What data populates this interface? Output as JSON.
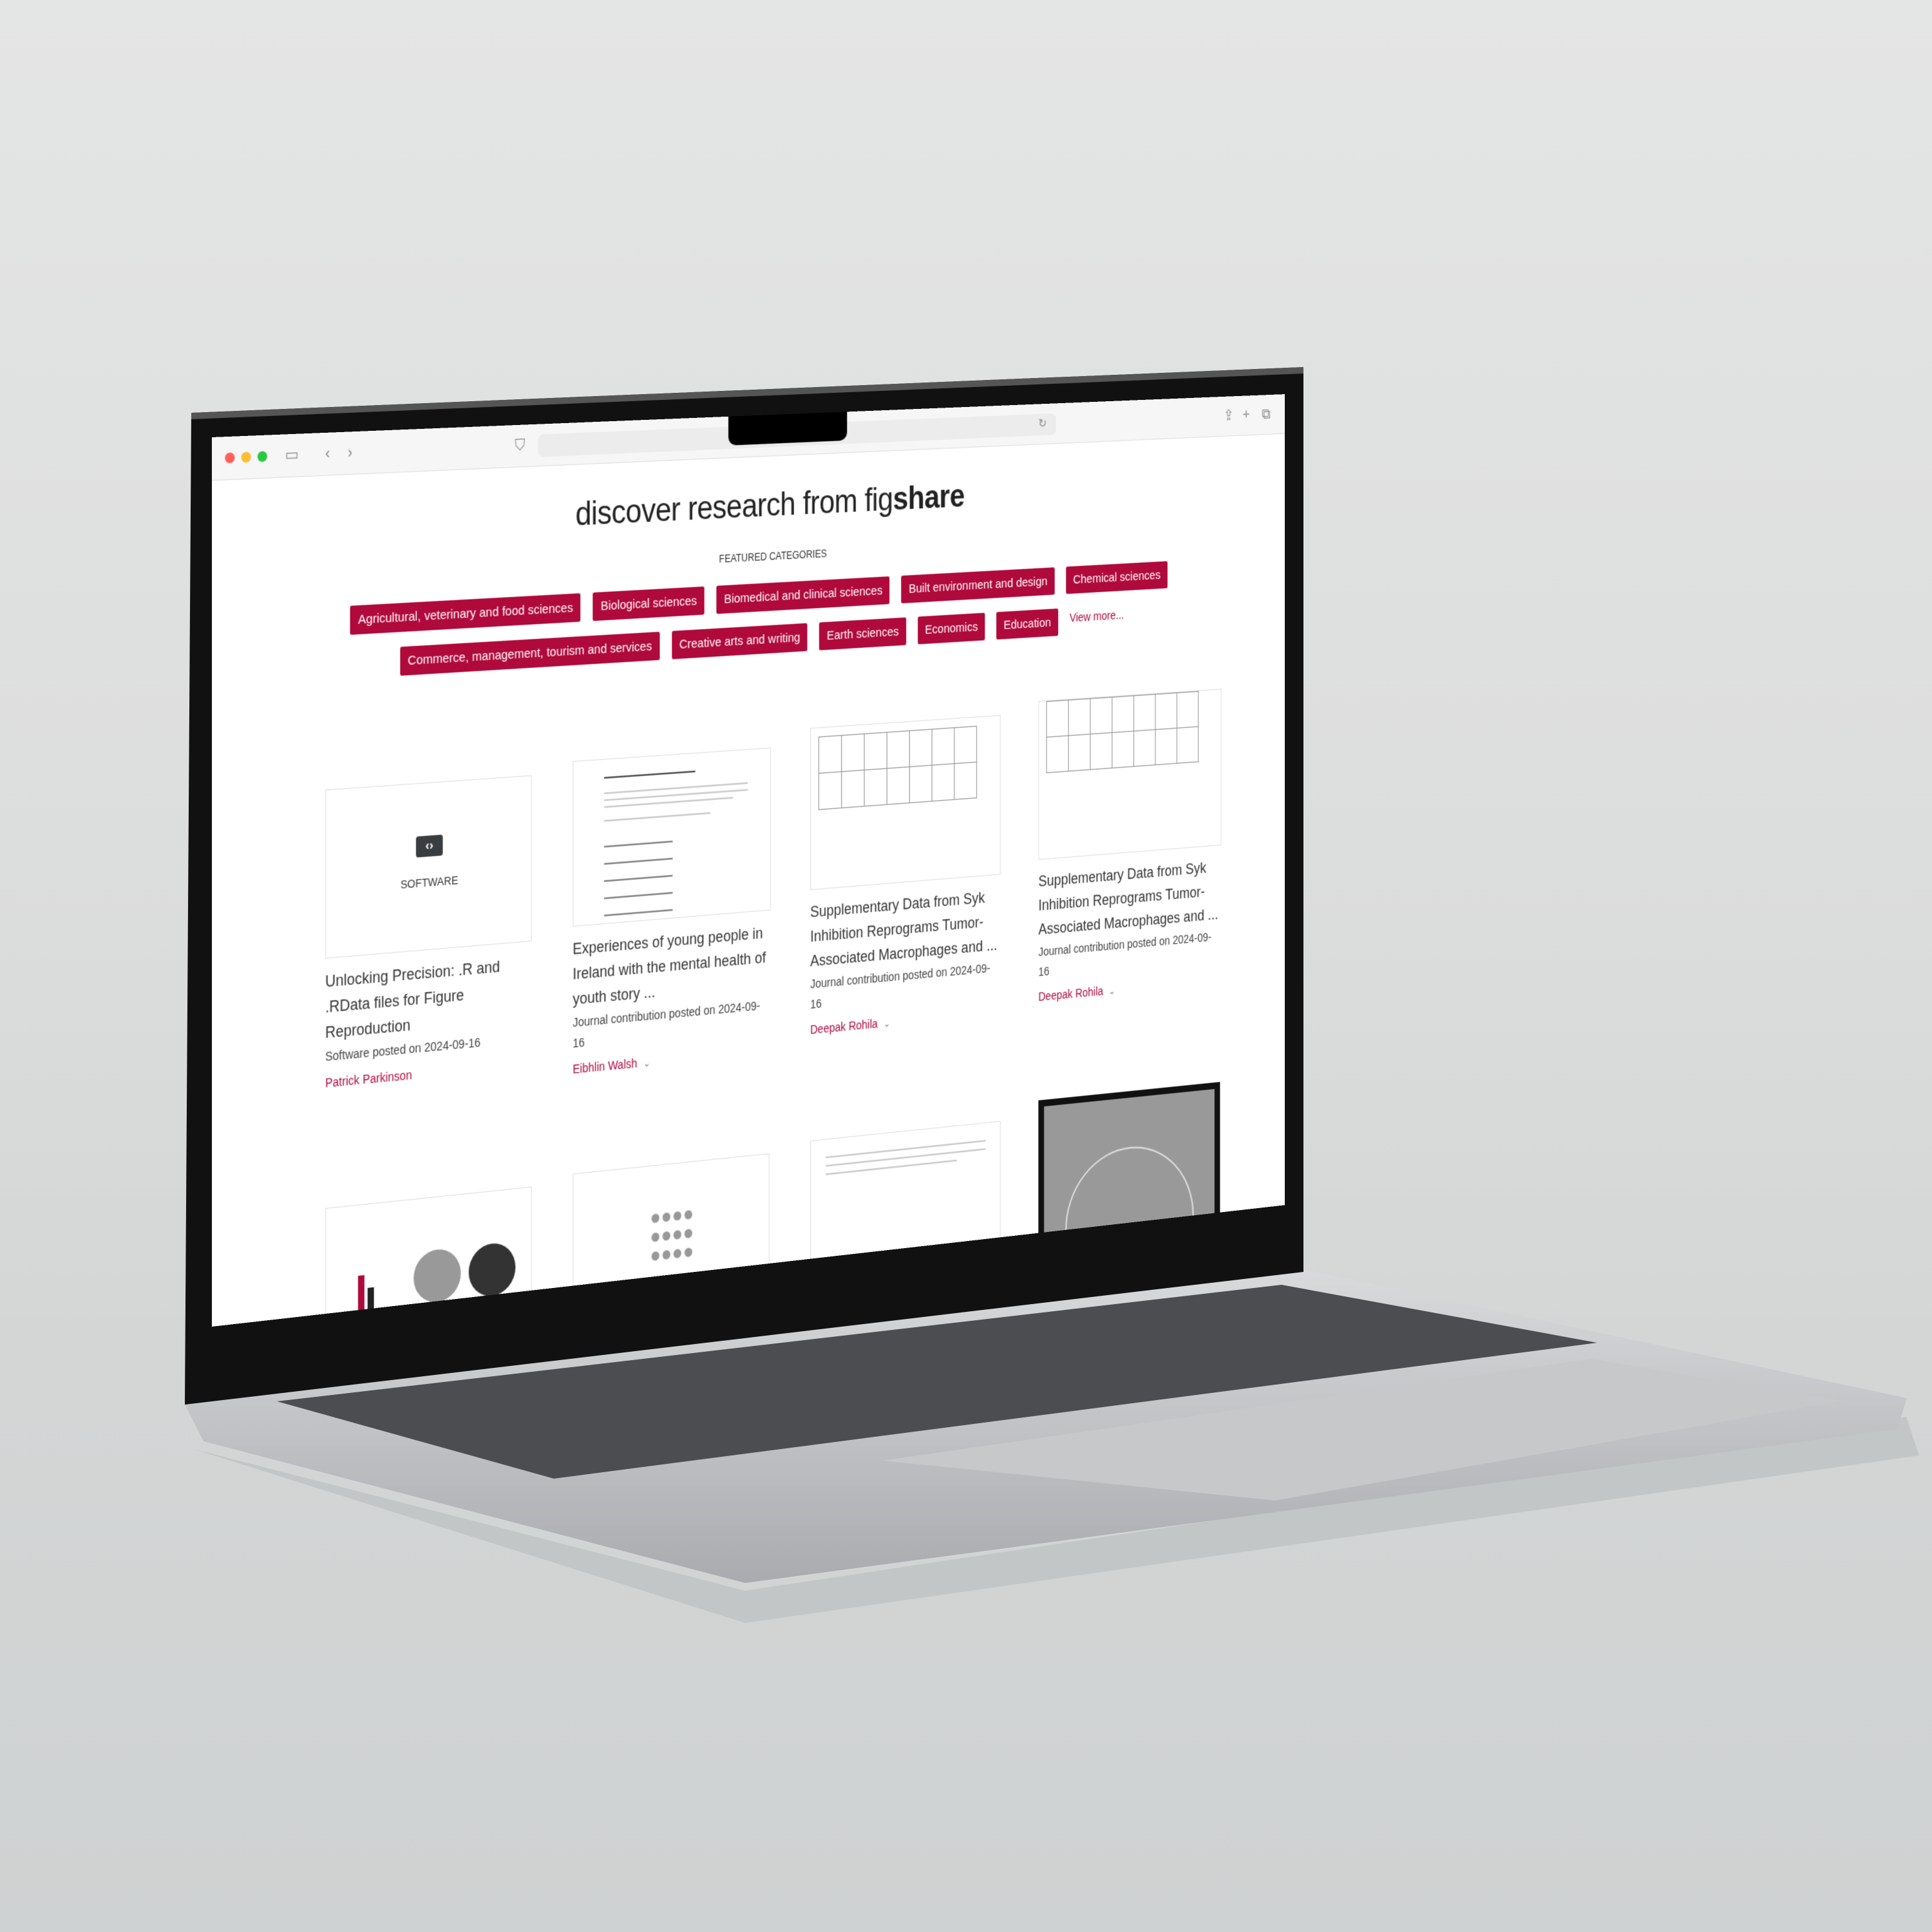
{
  "colors": {
    "accent": "#b0093b",
    "background": "#dfe0e0"
  },
  "browser": {
    "icons": [
      "close-dot",
      "minimize-dot",
      "zoom-dot",
      "sidebar-icon",
      "back-icon",
      "forward-icon",
      "shield-icon",
      "reload-icon",
      "share-icon",
      "new-tab-icon",
      "tabs-icon"
    ],
    "address": ""
  },
  "hero": {
    "title_light": "discover research from fig",
    "title_bold": "share",
    "featured_label": "FEATURED CATEGORIES"
  },
  "categories_row1": [
    "Agricultural, veterinary and food sciences",
    "Biological sciences",
    "Biomedical and clinical sciences",
    "Built environment and design",
    "Chemical sciences"
  ],
  "categories_row2": [
    "Commerce, management, tourism and services",
    "Creative arts and writing",
    "Earth sciences",
    "Economics",
    "Education"
  ],
  "view_more": "View more...",
  "cards": [
    {
      "thumb_label": "SOFTWARE",
      "title": "Unlocking Precision: .R and .RData files for Figure Reproduction",
      "meta": "Software posted on 2024-09-16",
      "author": "Patrick Parkinson"
    },
    {
      "title": "Experiences of young people in Ireland with the mental health of youth story ...",
      "meta": "Journal contribution posted on 2024-09-16",
      "author": "Eibhlin Walsh"
    },
    {
      "title": "Supplementary Data from Syk Inhibition Reprograms Tumor-Associated Macrophages and ...",
      "meta": "Journal contribution posted on 2024-09-16",
      "author": "Deepak Rohila"
    },
    {
      "title": "Supplementary Data from Syk Inhibition Reprograms Tumor-Associated Macrophages and ...",
      "meta": "Journal contribution posted on 2024-09-16",
      "author": "Deepak Rohila"
    }
  ]
}
